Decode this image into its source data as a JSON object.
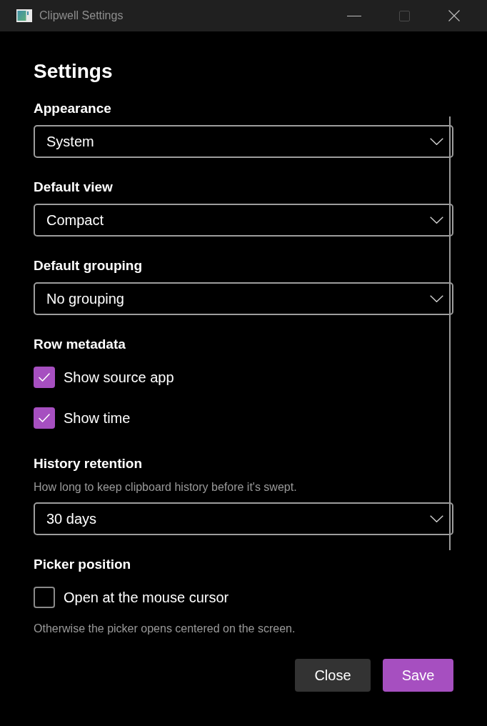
{
  "window": {
    "title": "Clipwell Settings",
    "controls": [
      {
        "kind": "minimize",
        "disabled": false
      },
      {
        "kind": "maximize",
        "disabled": true
      },
      {
        "kind": "close",
        "disabled": false
      }
    ]
  },
  "heading": "Settings",
  "sections": [
    {
      "label": "Appearance",
      "items": [
        {
          "kind": "select",
          "value": "System"
        }
      ]
    },
    {
      "label": "Default view",
      "items": [
        {
          "kind": "select",
          "value": "Compact"
        }
      ]
    },
    {
      "label": "Default grouping",
      "items": [
        {
          "kind": "select",
          "value": "No grouping"
        }
      ]
    },
    {
      "label": "Row metadata",
      "items": [
        {
          "kind": "checkbox",
          "label": "Show source app",
          "checked": true
        },
        {
          "kind": "checkbox",
          "label": "Show time",
          "checked": true
        }
      ]
    },
    {
      "label": "History retention",
      "items": [
        {
          "kind": "note",
          "text": "How long to keep clipboard history before it's swept."
        },
        {
          "kind": "select",
          "value": "30 days"
        }
      ]
    },
    {
      "label": "Picker position",
      "items": [
        {
          "kind": "checkbox",
          "label": "Open at the mouse cursor",
          "checked": false
        },
        {
          "kind": "note",
          "text": "Otherwise the picker opens centered on the screen."
        }
      ]
    }
  ],
  "buttons": [
    {
      "kind": "secondary",
      "label": "Close"
    },
    {
      "kind": "primary",
      "label": "Save"
    }
  ]
}
